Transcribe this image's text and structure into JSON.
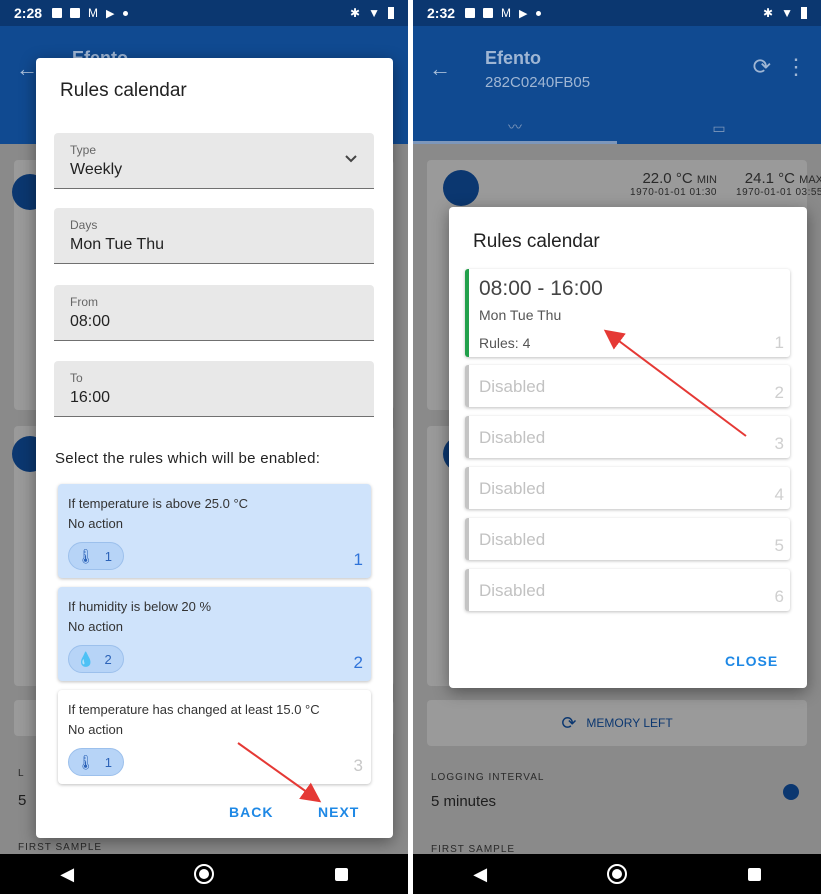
{
  "left": {
    "status": {
      "time": "2:28"
    },
    "app_bar": {
      "title": "Efento"
    },
    "dialog": {
      "title": "Rules calendar",
      "fields": [
        {
          "label": "Type",
          "value": "Weekly"
        },
        {
          "label": "Days",
          "value": "Mon Tue Thu"
        },
        {
          "label": "From",
          "value": "08:00"
        },
        {
          "label": "To",
          "value": "16:00"
        }
      ],
      "select_caption": "Select the rules which will be enabled:",
      "rules": [
        {
          "condition": "If temperature is above 25.0 °C",
          "action": "No action",
          "chip": "1",
          "number": "1",
          "selected": true
        },
        {
          "condition": "If humidity is below 20 %",
          "action": "No action",
          "chip": "2",
          "number": "2",
          "selected": true
        },
        {
          "condition": "If temperature has changed at least 15.0 °C",
          "action": "No action",
          "chip": "1",
          "number": "3",
          "selected": false
        }
      ],
      "back_label": "BACK",
      "next_label": "NEXT"
    },
    "bg": {
      "logging_interval_letter": "L",
      "value_letter": "5",
      "first_sample": "FIRST SAMPLE"
    }
  },
  "right": {
    "status": {
      "time": "2:32"
    },
    "app_bar": {
      "title": "Efento",
      "subtitle": "282C0240FB05"
    },
    "stats": [
      {
        "value": "22.0 °C",
        "kind": "MIN",
        "date": "1970-01-01 01:30"
      },
      {
        "value": "24.1 °C",
        "kind": "MAX",
        "date": "1970-01-01 03:55"
      }
    ],
    "dialog": {
      "title": "Rules calendar",
      "entries": [
        {
          "time": "08:00 - 16:00",
          "days": "Mon Tue Thu",
          "rules": "Rules: 4",
          "number": "1",
          "active": true
        },
        {
          "label": "Disabled",
          "number": "2"
        },
        {
          "label": "Disabled",
          "number": "3"
        },
        {
          "label": "Disabled",
          "number": "4"
        },
        {
          "label": "Disabled",
          "number": "5"
        },
        {
          "label": "Disabled",
          "number": "6"
        }
      ],
      "close_label": "CLOSE"
    },
    "bg": {
      "memory_left": "MEMORY LEFT",
      "logging_interval_label": "LOGGING INTERVAL",
      "logging_interval_value": "5 minutes",
      "first_sample": "FIRST SAMPLE"
    }
  },
  "icons": {
    "back": "arrow-left-icon",
    "sync": "sync-icon",
    "menu": "more-vert-icon",
    "thermometer": "thermometer-icon",
    "humidity": "humidity-icon",
    "chevron": "chevron-down-icon"
  },
  "colors": {
    "app_bar": "#104a91",
    "status_bar": "#0b3770",
    "accent": "#1e88e5",
    "selected_rule": "#cfe3fb",
    "active_entry": "#22a04b",
    "arrow": "#e53935"
  }
}
